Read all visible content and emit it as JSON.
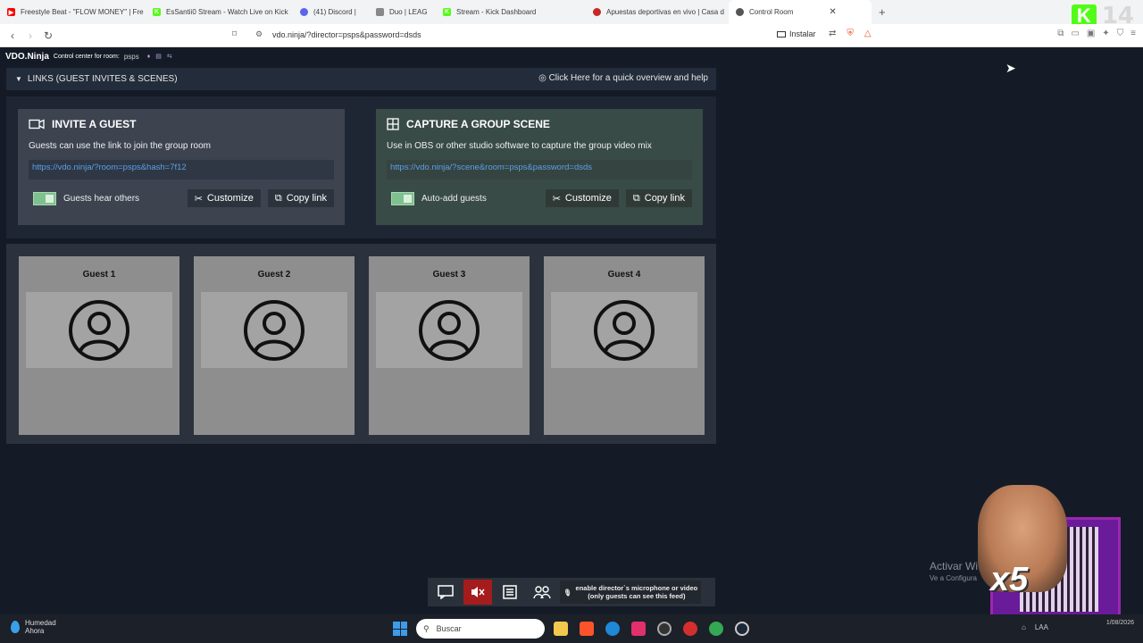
{
  "browser": {
    "tabs": [
      {
        "label": "Freestyle Beat - \"FLOW MONEY\" | Fre",
        "color": "#ff0000"
      },
      {
        "label": "EsSantii0 Stream - Watch Live on Kick",
        "color": "#53fc18"
      },
      {
        "label": "(41) Discord | ",
        "color": "#5865f2"
      },
      {
        "label": "Duo | LEAG",
        "color": "#888888"
      },
      {
        "label": "Stream - Kick Dashboard",
        "color": "#53fc18"
      },
      {
        "label": "Apuestas deportivas en vivo | Casa d",
        "color": "#c62828"
      },
      {
        "label": "Control Room",
        "color": "#555555",
        "active": true
      }
    ],
    "url": "vdo.ninja/?director=psps&password=dsds",
    "install_label": "Instalar",
    "kick_badge": {
      "letter": "K",
      "count": "14"
    }
  },
  "app": {
    "brand": "VDO.Ninja",
    "room_caption": "Control center for room:",
    "room_name": "psps",
    "links_header": "LINKS (GUEST INVITES & SCENES)",
    "help_link": "Click Here for a quick overview and help",
    "invite": {
      "title": "INVITE A GUEST",
      "description": "Guests can use the link to join the group room",
      "link": "https://vdo.ninja/?room=psps&hash=7f12",
      "toggle_label": "Guests hear others",
      "customize_label": "Customize",
      "copy_label": "Copy link"
    },
    "capture": {
      "title": "CAPTURE A GROUP SCENE",
      "description": "Use in OBS or other studio software to capture the group video mix",
      "link": "https://vdo.ninja/?scene&room=psps&password=dsds",
      "toggle_label": "Auto-add guests",
      "customize_label": "Customize",
      "copy_label": "Copy link"
    },
    "guests": [
      {
        "label": "Guest 1"
      },
      {
        "label": "Guest 2"
      },
      {
        "label": "Guest 3"
      },
      {
        "label": "Guest 4"
      }
    ],
    "mic_hint_line1": "enable director`s microphone or video",
    "mic_hint_line2": "(only guests can see this feed)"
  },
  "overlay": {
    "activate_title": "Activar Wi",
    "activate_sub": "Ve a Configura",
    "promo": "x5"
  },
  "taskbar": {
    "weather_title": "Humedad",
    "weather_sub": "Ahora",
    "search_placeholder": "Buscar",
    "lang": "LAA",
    "date": "1/08/2026"
  }
}
